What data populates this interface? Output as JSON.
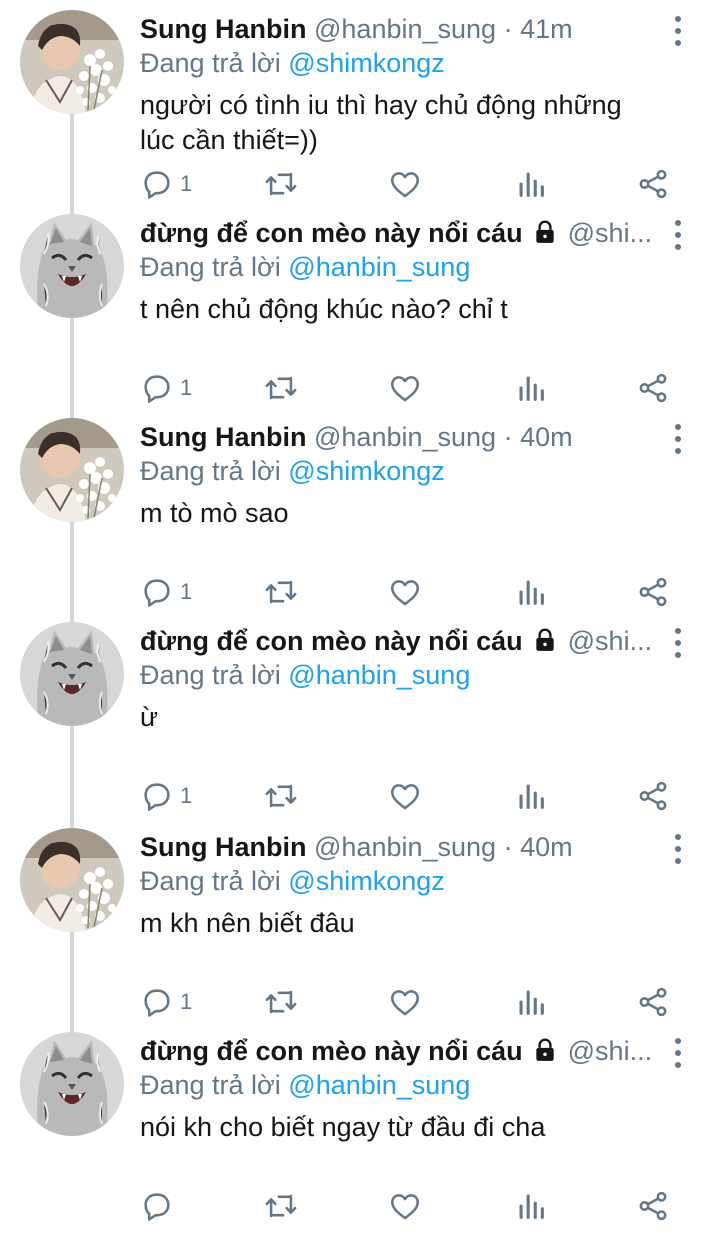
{
  "tweets": [
    {
      "name": "Sung Hanbin",
      "handle": "@hanbin_sung",
      "time": "41m",
      "replying_label": "Đang trả lời",
      "replying_to": "@shimkongz",
      "text": "người có tình iu thì hay chủ động những lúc cần thiết=))",
      "reply_count": "1",
      "avatar": "flowers-person"
    },
    {
      "name": "đừng để con mèo này nổi cáu",
      "handle": "@shi...",
      "time": "",
      "locked": true,
      "replying_label": "Đang trả lời",
      "replying_to": "@hanbin_sung",
      "text": "t nên chủ động khúc nào? chỉ t",
      "reply_count": "1",
      "avatar": "cat"
    },
    {
      "name": "Sung Hanbin",
      "handle": "@hanbin_sung",
      "time": "40m",
      "replying_label": "Đang trả lời",
      "replying_to": "@shimkongz",
      "text": "m tò mò sao",
      "reply_count": "1",
      "avatar": "flowers-person"
    },
    {
      "name": "đừng để con mèo này nổi cáu",
      "handle": "@shi...",
      "time": "",
      "locked": true,
      "replying_label": "Đang trả lời",
      "replying_to": "@hanbin_sung",
      "text": "ừ",
      "reply_count": "1",
      "avatar": "cat"
    },
    {
      "name": "Sung Hanbin",
      "handle": "@hanbin_sung",
      "time": "40m",
      "replying_label": "Đang trả lời",
      "replying_to": "@shimkongz",
      "text": "m kh nên biết đâu",
      "reply_count": "1",
      "avatar": "flowers-person"
    },
    {
      "name": "đừng để con mèo này nổi cáu",
      "handle": "@shi...",
      "time": "",
      "locked": true,
      "replying_label": "Đang trả lời",
      "replying_to": "@hanbin_sung",
      "text": "nói kh cho biết ngay từ đầu đi cha",
      "reply_count": "",
      "avatar": "cat"
    }
  ],
  "icons": {
    "reply": "reply-icon",
    "retweet": "retweet-icon",
    "like": "heart-icon",
    "stats": "stats-icon",
    "share": "share-icon",
    "more": "more-vertical-icon",
    "lock": "lock-icon"
  },
  "colors": {
    "text": "#14171a",
    "muted": "#657786",
    "link": "#1da1f2",
    "thread_line": "#d3d7db"
  }
}
